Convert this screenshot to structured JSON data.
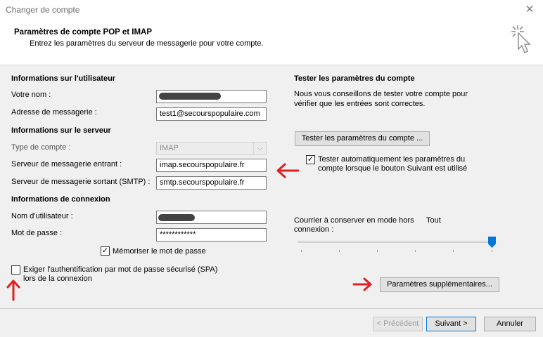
{
  "window": {
    "title": "Changer de compte",
    "close_glyph": "✕"
  },
  "header": {
    "title": "Paramètres de compte POP et IMAP",
    "subtitle": "Entrez les paramètres du serveur de messagerie pour votre compte."
  },
  "user_info": {
    "section": "Informations sur l'utilisateur",
    "name_label": "Votre nom :",
    "name_value": "",
    "email_label": "Adresse de messagerie :",
    "email_value": "test1@secourspopulaire.com"
  },
  "server_info": {
    "section": "Informations sur le serveur",
    "account_type_label": "Type de compte :",
    "account_type_value": "IMAP",
    "incoming_label": "Serveur de messagerie entrant :",
    "incoming_value": "imap.secourspopulaire.fr",
    "outgoing_label": "Serveur de messagerie sortant (SMTP) :",
    "outgoing_value": "smtp.secourspopulaire.fr"
  },
  "login_info": {
    "section": "Informations de connexion",
    "username_label": "Nom d'utilisateur :",
    "username_value": "",
    "password_label": "Mot de passe :",
    "password_value": "************",
    "remember_label": "Mémoriser le mot de passe",
    "remember_checked": true,
    "spa_label_line1": "Exiger l'authentification par mot de passe sécurisé (SPA)",
    "spa_label_line2": "lors de la connexion",
    "spa_checked": false
  },
  "test": {
    "section": "Tester les paramètres du compte",
    "advice_line1": "Nous vous conseillons de tester votre compte pour",
    "advice_line2": "vérifier que les entrées sont correctes.",
    "test_button": "Tester les paramètres du compte ...",
    "auto_test_line1": "Tester automatiquement les paramètres du",
    "auto_test_line2": "compte lorsque le bouton Suivant est utilisé",
    "auto_test_checked": true
  },
  "offline": {
    "label_line1": "Courrier à conserver en mode hors",
    "label_line2": "connexion :",
    "value_text": "Tout",
    "slider_fraction": 1.0
  },
  "more_settings_button": "Paramètres supplémentaires...",
  "footer": {
    "back": "< Précédent",
    "next": "Suivant >",
    "cancel": "Annuler"
  },
  "colors": {
    "accent": "#0078d7",
    "annotation_arrow": "#e02020"
  },
  "check_glyph": "✓"
}
